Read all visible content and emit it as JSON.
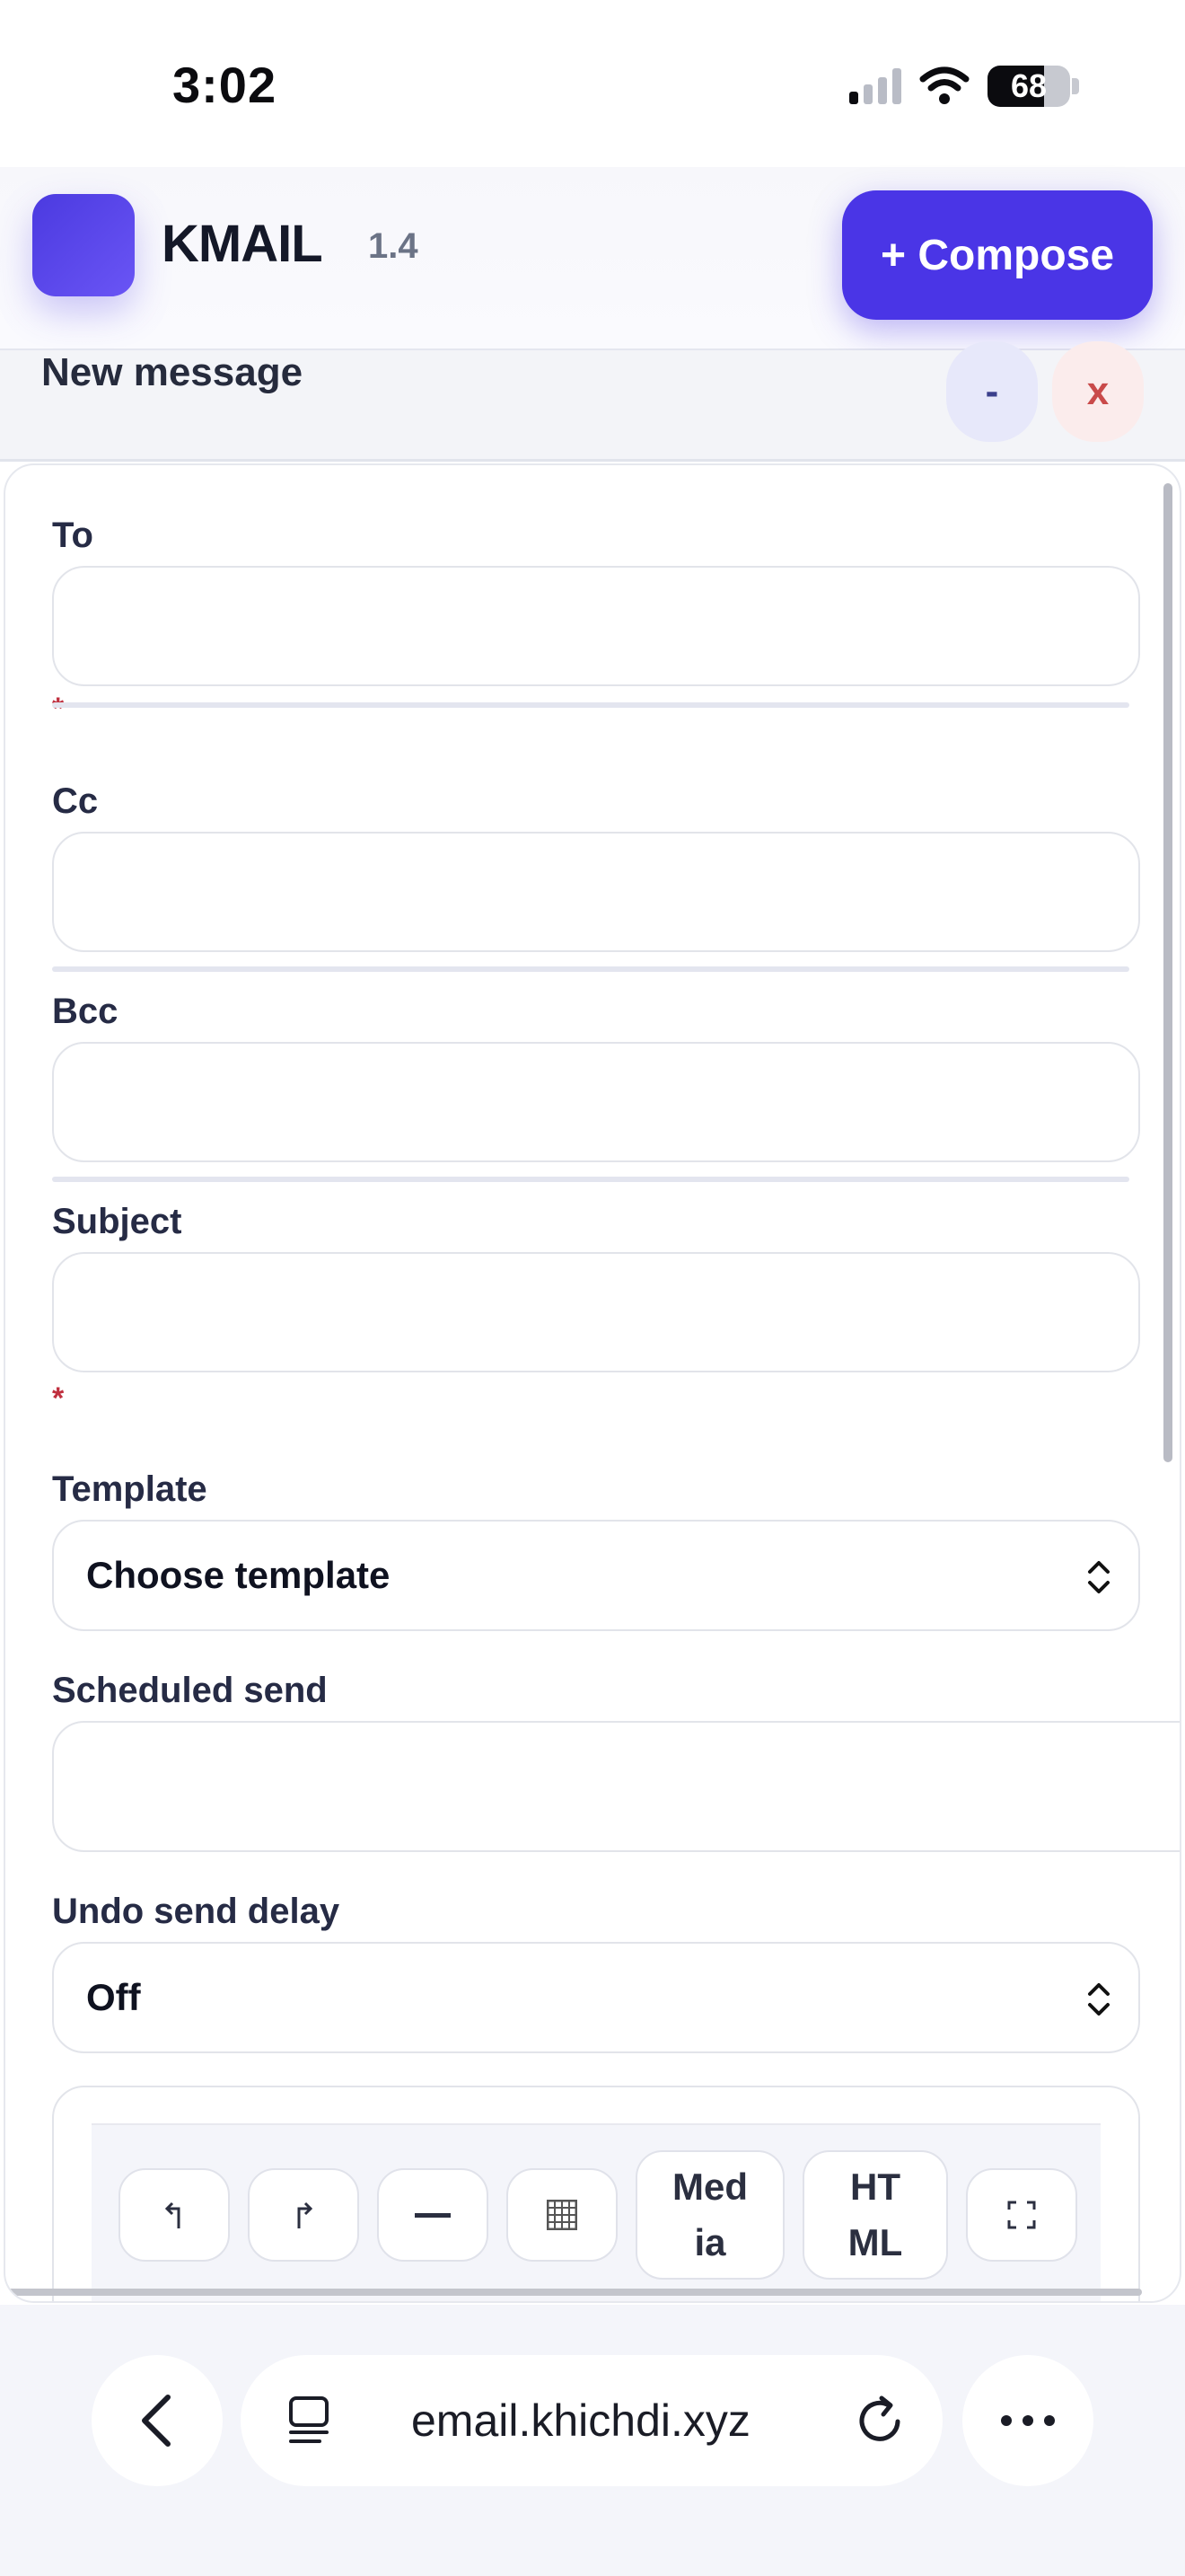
{
  "status_bar": {
    "time": "3:02",
    "battery": "68",
    "battery_fraction": 0.68
  },
  "header": {
    "app_name": "KMAIL",
    "version": "1.4",
    "compose_label": "+ Compose",
    "accent_color": "#4a35e6"
  },
  "message_bar": {
    "title": "New message",
    "minimize_label": "-",
    "close_label": "x"
  },
  "form": {
    "to_label": "To",
    "to_value": "",
    "to_required_mark": "*",
    "cc_label": "Cc",
    "cc_value": "",
    "bcc_label": "Bcc",
    "bcc_value": "",
    "subject_label": "Subject",
    "subject_value": "",
    "subject_required_mark": "*",
    "template_label": "Template",
    "template_selected": "Choose template",
    "scheduled_label": "Scheduled send",
    "scheduled_value": "",
    "undo_label": "Undo send delay",
    "undo_selected": "Off"
  },
  "toolbar": {
    "undo_icon": "undo-icon",
    "redo_icon": "redo-icon",
    "hr_icon": "horizontal-rule-icon",
    "table_icon": "table-icon",
    "media_line1": "Med",
    "media_line2": "ia",
    "html_line1": "HT",
    "html_line2": "ML",
    "fullscreen_icon": "fullscreen-icon"
  },
  "browser": {
    "url": "email.khichdi.xyz",
    "back_icon": "chevron-left-icon",
    "tabs_icon": "tabs-icon",
    "reload_icon": "reload-icon",
    "more_icon": "more-icon"
  }
}
